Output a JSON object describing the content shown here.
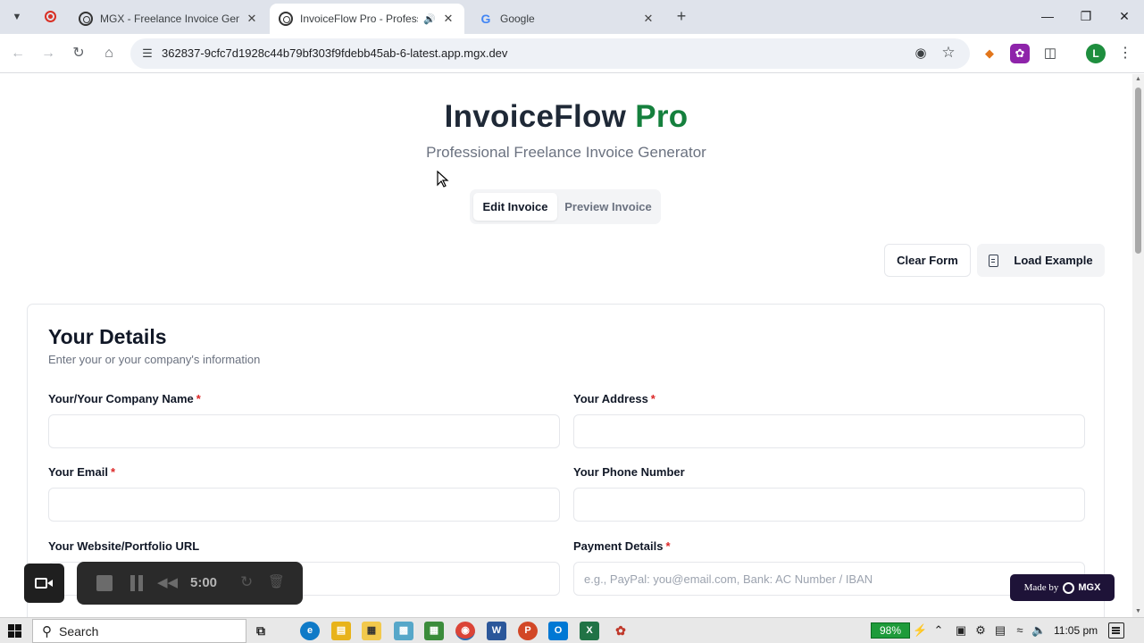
{
  "browser": {
    "tabs": [
      {
        "title": "MGX - Freelance Invoice Gener",
        "active": false
      },
      {
        "title": "InvoiceFlow Pro - Professio",
        "active": true
      },
      {
        "title": "Google",
        "active": false
      }
    ],
    "url": "362837-9cfc7d1928c44b79bf303f9fdebb45ab-6-latest.app.mgx.dev",
    "profile_initial": "L"
  },
  "app": {
    "title_part1": "InvoiceFlow",
    "title_part2": "Pro",
    "subtitle": "Professional Freelance Invoice Generator",
    "mode_tabs": [
      {
        "label": "Edit Invoice",
        "active": true
      },
      {
        "label": "Preview Invoice",
        "active": false
      }
    ],
    "actions": {
      "clear_label": "Clear Form",
      "load_label": "Load Example"
    },
    "colors": {
      "brand_dark": "#1f2937",
      "brand_green": "#15803d",
      "required": "#dc2626"
    }
  },
  "details_card": {
    "title": "Your Details",
    "description": "Enter your or your company's information",
    "fields": {
      "company_name": {
        "label": "Your/Your Company Name",
        "required": "*",
        "value": "",
        "placeholder": ""
      },
      "address": {
        "label": "Your Address",
        "required": "*",
        "value": "",
        "placeholder": ""
      },
      "email": {
        "label": "Your Email",
        "required": "*",
        "value": "",
        "placeholder": ""
      },
      "phone": {
        "label": "Your Phone Number",
        "value": "",
        "placeholder": ""
      },
      "website": {
        "label": "Your Website/Portfolio URL",
        "value": "",
        "placeholder": ""
      },
      "payment": {
        "label": "Payment Details",
        "required": "*",
        "value": "",
        "placeholder": "e.g., PayPal: you@email.com, Bank: AC Number / IBAN"
      }
    }
  },
  "badge": {
    "made_by": "Made by",
    "brand": "MGX"
  },
  "recorder": {
    "time": "5:00"
  },
  "taskbar": {
    "search_label": "Search",
    "battery": "98%",
    "time": "11:05 pm"
  }
}
